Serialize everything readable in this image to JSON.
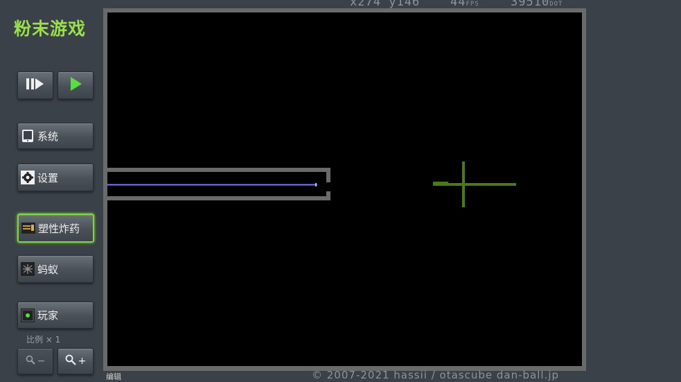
{
  "app": {
    "title": "粉末游戏"
  },
  "hud": {
    "x_label": "x",
    "x_value": "274",
    "y_label": "y",
    "y_value": "146",
    "fps_value": "44",
    "fps_unit": "FPS",
    "dot_value": "39510",
    "dot_unit": "DOT"
  },
  "controls": {
    "step_icon": "step-icon",
    "play_icon": "play-icon",
    "system_label": "系统",
    "settings_label": "设置",
    "c4_label": "塑性炸药",
    "ant_label": "蚂蚁",
    "player_label": "玩家",
    "scale_label": "比例 × 1",
    "zoom_out_label": "−",
    "zoom_in_label": "+"
  },
  "status": {
    "edit_label": "编辑",
    "copyright": "© 2007-2021 hassii / otascube dan-ball.jp"
  },
  "colors": {
    "accent": "#9ae04a",
    "wall": "#6a6a6a",
    "laser": "#7a7aff",
    "plant": "#4a7a10"
  }
}
